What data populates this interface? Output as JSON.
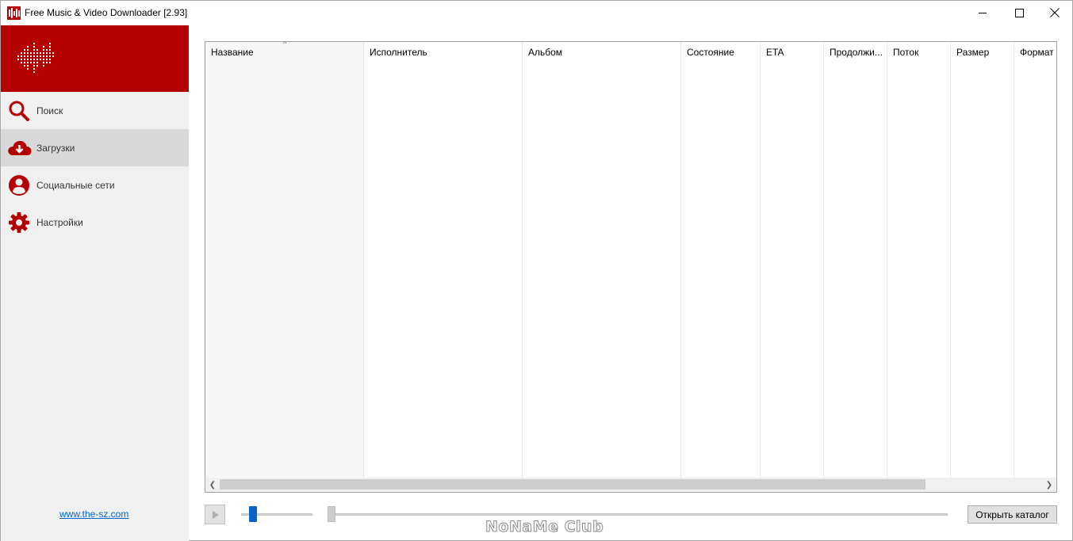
{
  "window": {
    "title": "Free Music & Video Downloader [2.93]",
    "controls": [
      "minimize-icon",
      "maximize-icon",
      "close-icon"
    ]
  },
  "sidebar": {
    "logo": "waveform-logo",
    "items": [
      {
        "label": "Поиск",
        "icon": "search-icon",
        "active": false
      },
      {
        "label": "Загрузки",
        "icon": "cloud-download-icon",
        "active": true
      },
      {
        "label": "Социальные сети",
        "icon": "user-circle-icon",
        "active": false
      },
      {
        "label": "Настройки",
        "icon": "gear-icon",
        "active": false
      }
    ],
    "site_link": "www.the-sz.com"
  },
  "table": {
    "columns": [
      "Название",
      "Исполнитель",
      "Альбом",
      "Состояние",
      "ETA",
      "Продолжи...",
      "Поток",
      "Размер",
      "Формат"
    ],
    "sorted_column": "Название",
    "rows": []
  },
  "controls": {
    "open_folder_label": "Открыть каталог"
  },
  "watermark": "NoNaMe Club",
  "colors": {
    "accent": "#b30000",
    "slider_thumb": "#0a64c8",
    "link": "#0066cc"
  }
}
